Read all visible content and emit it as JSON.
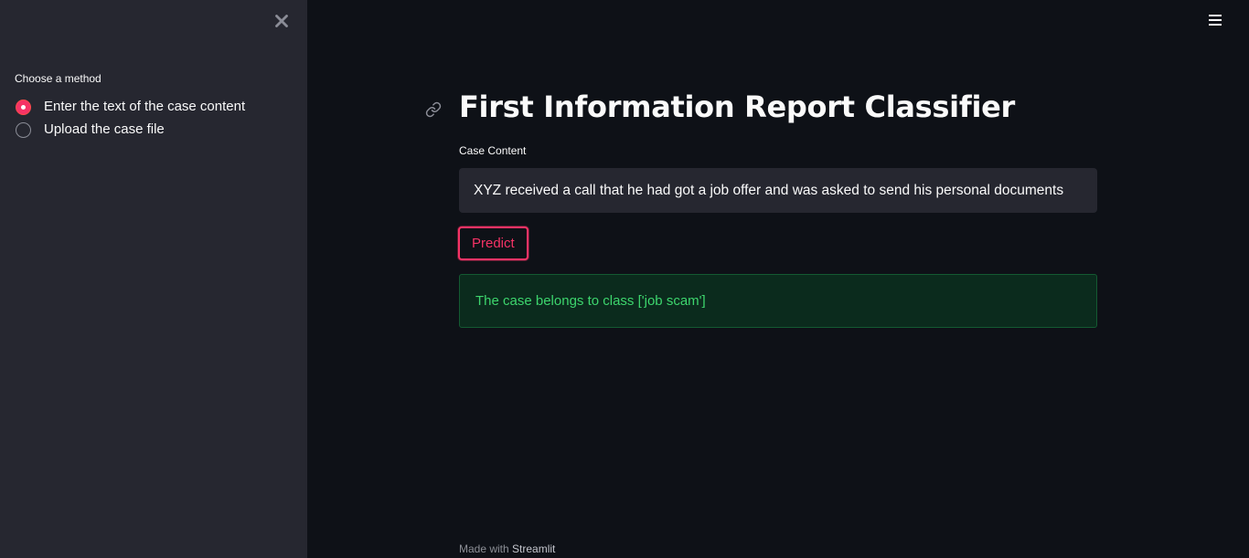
{
  "sidebar": {
    "close_icon": "close-icon",
    "radio_label": "Choose a method",
    "options": [
      {
        "label": "Enter the text of the case content",
        "selected": true
      },
      {
        "label": "Upload the case file",
        "selected": false
      }
    ]
  },
  "header": {
    "menu_icon": "hamburger-icon"
  },
  "main": {
    "title": "First Information Report Classifier",
    "anchor_icon": "link-icon",
    "case_content_label": "Case Content",
    "case_content_value": "XYZ received a call that he had got a job offer and was asked to send his personal documents",
    "predict_label": "Predict",
    "result_text": "The case belongs to class ['job scam']"
  },
  "footer": {
    "prefix": "Made with ",
    "brand": "Streamlit"
  },
  "colors": {
    "accent": "#f63366",
    "background": "#0e1117",
    "sidebar_bg": "#262730",
    "success_text": "#3dd56d",
    "success_bg": "#0b2b1d"
  }
}
